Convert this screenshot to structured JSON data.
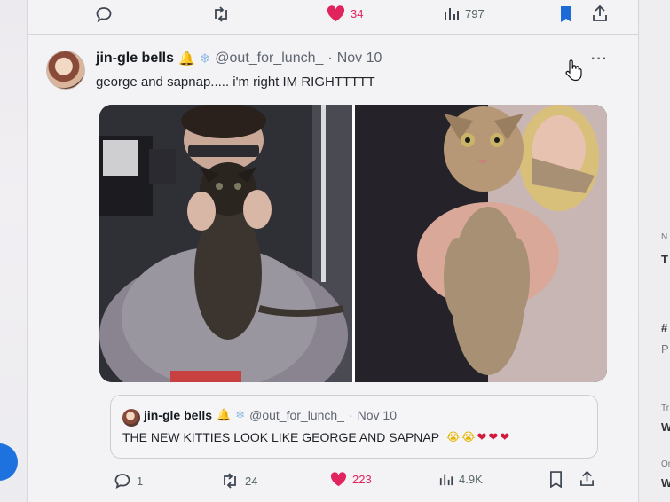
{
  "top_actions": {
    "reply_count": "",
    "like_count": "34",
    "views_count": "797"
  },
  "tweet": {
    "display_name": "jin-gle bells",
    "badge_bell_icon": "bell-emoji",
    "badge_snow_icon": "snowflake-emoji",
    "handle": "@out_for_lunch_",
    "separator": "·",
    "date": "Nov 10",
    "more_label": "···",
    "text": "george and sapnap..... i'm right IM RIGHTTTTT"
  },
  "quote": {
    "display_name": "jin-gle bells",
    "handle": "@out_for_lunch_",
    "separator": "·",
    "date": "Nov 10",
    "text": "THE NEW KITTIES LOOK LIKE GEORGE AND SAPNAP"
  },
  "bottom_actions": {
    "reply_count": "1",
    "retweet_count": "24",
    "like_count": "223",
    "views_count": "4.9K"
  },
  "right_sidebar": {
    "letters": [
      "N",
      "T",
      "#",
      "P",
      "Tr",
      "W",
      "Or",
      "W"
    ]
  },
  "colors": {
    "like": "#e0245e",
    "bookmark": "#1d6bd6",
    "fab": "#1d72e0"
  }
}
